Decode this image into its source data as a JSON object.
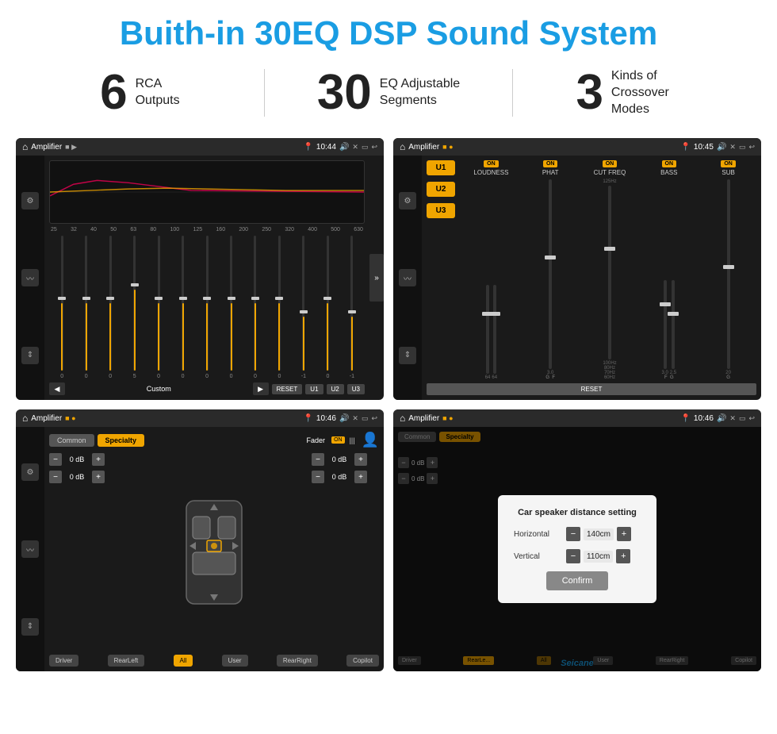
{
  "header": {
    "title": "Buith-in 30EQ DSP Sound System"
  },
  "stats": [
    {
      "number": "6",
      "label": "RCA\nOutputs"
    },
    {
      "number": "30",
      "label": "EQ Adjustable\nSegments"
    },
    {
      "number": "3",
      "label": "Kinds of\nCrossover Modes"
    }
  ],
  "screens": {
    "eq": {
      "status_bar": {
        "app": "Amplifier",
        "time": "10:44"
      },
      "freq_labels": [
        "25",
        "32",
        "40",
        "50",
        "63",
        "80",
        "100",
        "125",
        "160",
        "200",
        "250",
        "320",
        "400",
        "500",
        "630"
      ],
      "slider_values": [
        "0",
        "0",
        "0",
        "5",
        "0",
        "0",
        "0",
        "0",
        "0",
        "0",
        "-1",
        "0",
        "-1"
      ],
      "bottom": {
        "custom": "Custom",
        "reset": "RESET",
        "u1": "U1",
        "u2": "U2",
        "u3": "U3"
      }
    },
    "amp": {
      "status_bar": {
        "app": "Amplifier",
        "time": "10:45"
      },
      "presets": [
        "U1",
        "U2",
        "U3"
      ],
      "sections": [
        {
          "label": "LOUDNESS",
          "on": true
        },
        {
          "label": "PHAT",
          "on": true
        },
        {
          "label": "CUT FREQ",
          "on": true
        },
        {
          "label": "BASS",
          "on": true
        },
        {
          "label": "SUB",
          "on": true
        }
      ],
      "reset_label": "RESET"
    },
    "speaker": {
      "status_bar": {
        "app": "Amplifier",
        "time": "10:46"
      },
      "tabs": [
        "Common",
        "Specialty"
      ],
      "fader_label": "Fader",
      "on_label": "ON",
      "db_controls": {
        "top_left": "0 dB",
        "top_right": "0 dB",
        "bottom_left": "0 dB",
        "bottom_right": "0 dB"
      },
      "position_buttons": [
        "Driver",
        "RearLeft",
        "All",
        "User",
        "RearRight",
        "Copilot"
      ]
    },
    "dialog": {
      "status_bar": {
        "app": "Amplifier",
        "time": "10:46"
      },
      "dialog": {
        "title": "Car speaker distance setting",
        "horizontal_label": "Horizontal",
        "horizontal_value": "140cm",
        "vertical_label": "Vertical",
        "vertical_value": "110cm",
        "confirm_label": "Confirm"
      }
    }
  },
  "watermark": "Seicane"
}
